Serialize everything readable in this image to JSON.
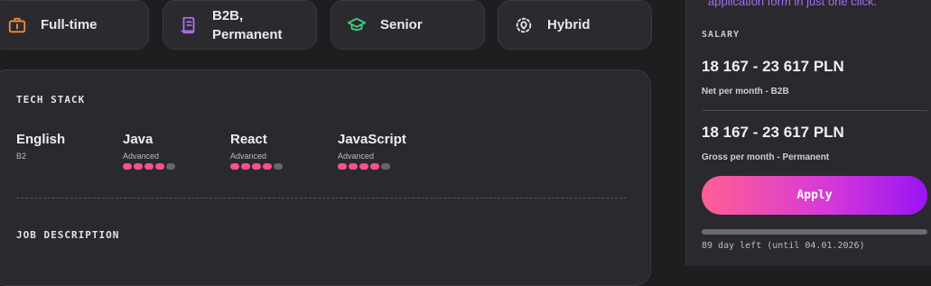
{
  "chips": [
    {
      "label": "Full-time",
      "icon": "briefcase-icon",
      "color": "#f08a3c"
    },
    {
      "label": "B2B,\nPermanent",
      "icon": "contract-icon",
      "color": "#b06cf2"
    },
    {
      "label": "Senior",
      "icon": "graduation-cap-icon",
      "color": "#3fcf7c"
    },
    {
      "label": "Hybrid",
      "icon": "location-pin-icon",
      "color": "#e8e8ea"
    }
  ],
  "tech_stack": {
    "title": "TECH STACK",
    "skills": [
      {
        "name": "English",
        "level": "B2",
        "dots_filled": null
      },
      {
        "name": "Java",
        "level": "Advanced",
        "dots_filled": 4
      },
      {
        "name": "React",
        "level": "Advanced",
        "dots_filled": 4
      },
      {
        "name": "JavaScript",
        "level": "Advanced",
        "dots_filled": 4
      }
    ],
    "dots_total": 5,
    "dot_color_filled": "#ff4f8b",
    "dot_color_empty": "#66666c"
  },
  "job_description": {
    "title": "JOB DESCRIPTION"
  },
  "sidebar": {
    "promo_text": "application form in just one click.",
    "salary_label": "SALARY",
    "salaries": [
      {
        "amount": "18 167 - 23 617 PLN",
        "note": "Net per month - B2B"
      },
      {
        "amount": "18 167 - 23 617 PLN",
        "note": "Gross per month - Permanent"
      }
    ],
    "apply_label": "Apply",
    "progress_fraction": 1.0,
    "deadline": "89 day left (until 04.01.2026)"
  }
}
